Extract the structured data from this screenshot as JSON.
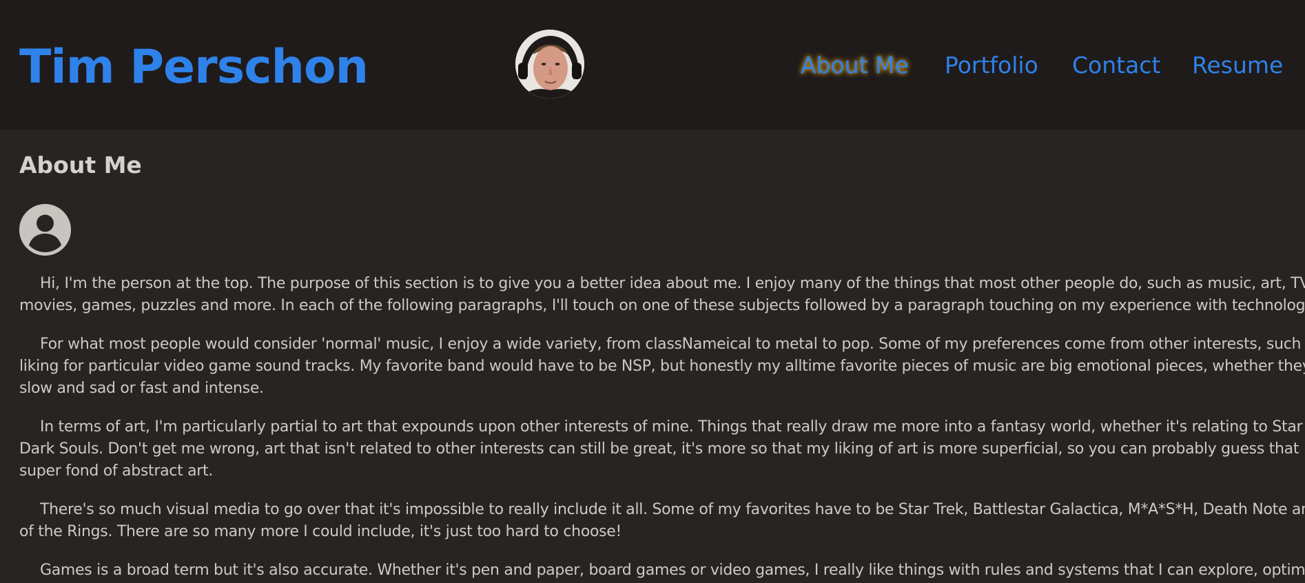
{
  "header": {
    "title": "Tim Perschon",
    "avatar_icon": "profile-photo",
    "nav": [
      {
        "label": "About Me",
        "active": true
      },
      {
        "label": "Portfolio",
        "active": false
      },
      {
        "label": "Contact",
        "active": false
      },
      {
        "label": "Resume",
        "active": false
      }
    ]
  },
  "colors": {
    "accent": "#2f82ea",
    "header_bg": "#1f1b1b",
    "page_bg": "#272424",
    "text": "#cdc9c5",
    "active_glow": "#e0a21c"
  },
  "main": {
    "section_title": "About Me",
    "section_icon": "user-circle-icon",
    "paragraphs": [
      {
        "lines": [
          "Hi, I'm the person at the top. The purpose of this section is to give you a better idea about me. I enjoy many of the things that most other people do, such as music, art, TV and",
          "movies, games, puzzles and more. In each of the following paragraphs, I'll touch on one of these subjects followed by a paragraph touching on my experience with technology."
        ]
      },
      {
        "lines": [
          "For what most people would consider 'normal' music, I enjoy a wide variety, from classNameical to metal to pop. Some of my preferences come from other interests, such as a",
          "liking for particular video game sound tracks. My favorite band would have to be NSP, but honestly my alltime favorite pieces of music are big emotional pieces, whether they're",
          "slow and sad or fast and intense."
        ]
      },
      {
        "lines": [
          "In terms of art, I'm particularly partial to art that expounds upon other interests of mine. Things that really draw me more into a fantasy world, whether it's relating to Star Trek or",
          "Dark Souls. Don't get me wrong, art that isn't related to other interests can still be great, it's more so that my liking of art is more superficial, so you can probably guess that I'm not",
          "super fond of abstract art."
        ]
      },
      {
        "lines": [
          "There's so much visual media to go over that it's impossible to really include it all. Some of my favorites have to be Star Trek, Battlestar Galactica, M*A*S*H, Death Note and Lord",
          "of the Rings. There are so many more I could include, it's just too hard to choose!"
        ]
      },
      {
        "lines": [
          "Games is a broad term but it's also accurate. Whether it's pen and paper, board games or video games, I really like things with rules and systems that I can explore, optimize, and"
        ]
      }
    ]
  }
}
